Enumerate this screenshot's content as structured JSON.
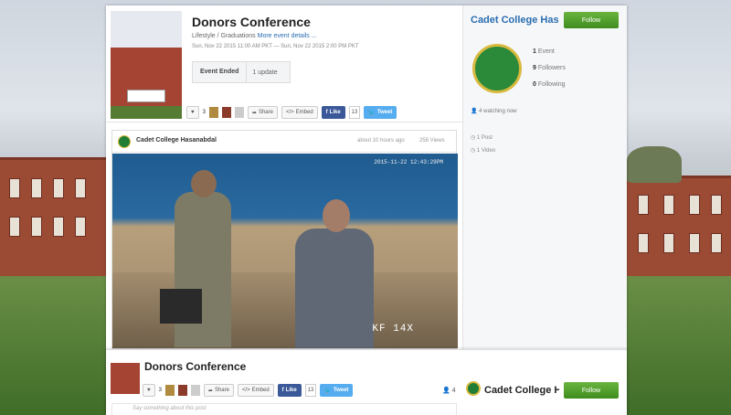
{
  "event": {
    "title": "Donors Conference",
    "category": "Lifestyle / Graduations",
    "more_link": "More event details ...",
    "dates": "Sun, Nov 22 2015 11:00 AM PKT — Sun, Nov 22 2015 2:00 PM PKT",
    "status": "Event Ended",
    "updates": "1 update"
  },
  "actions": {
    "like_count": "3",
    "share_label": "Share",
    "embed_label": "Embed",
    "fb_like_label": "Like",
    "fb_count": "13",
    "tweet_label": "Tweet"
  },
  "sidebar": {
    "org_name": "Cadet College Hasanabdal",
    "follow_label": "Follow",
    "events": "1 Event",
    "events_count": "1",
    "events_label": "Event",
    "followers_count": "9",
    "followers_label": "Followers",
    "following_count": "0",
    "following_label": "Following",
    "watching": "4 watching now",
    "posts": "1 Post",
    "videos": "1 Video"
  },
  "post": {
    "author": "Cadet College Hasanabdal",
    "time_ago": "about 10 hours ago",
    "views": "258 Views",
    "camera_timestamp": "2015-11-22 12:43:29PM",
    "camera_label": "KF  14X"
  },
  "sticky": {
    "title": "Donors Conference",
    "watching_count": "4",
    "org_name": "Cadet College Hasanabdal",
    "follow_label": "Follow",
    "comment_placeholder": "Say something about this post",
    "posts": "1 Post"
  },
  "colors": {
    "link_blue": "#2a6db0",
    "follow_green": "#4f9e2c",
    "facebook": "#3b5998",
    "twitter": "#55acee"
  }
}
